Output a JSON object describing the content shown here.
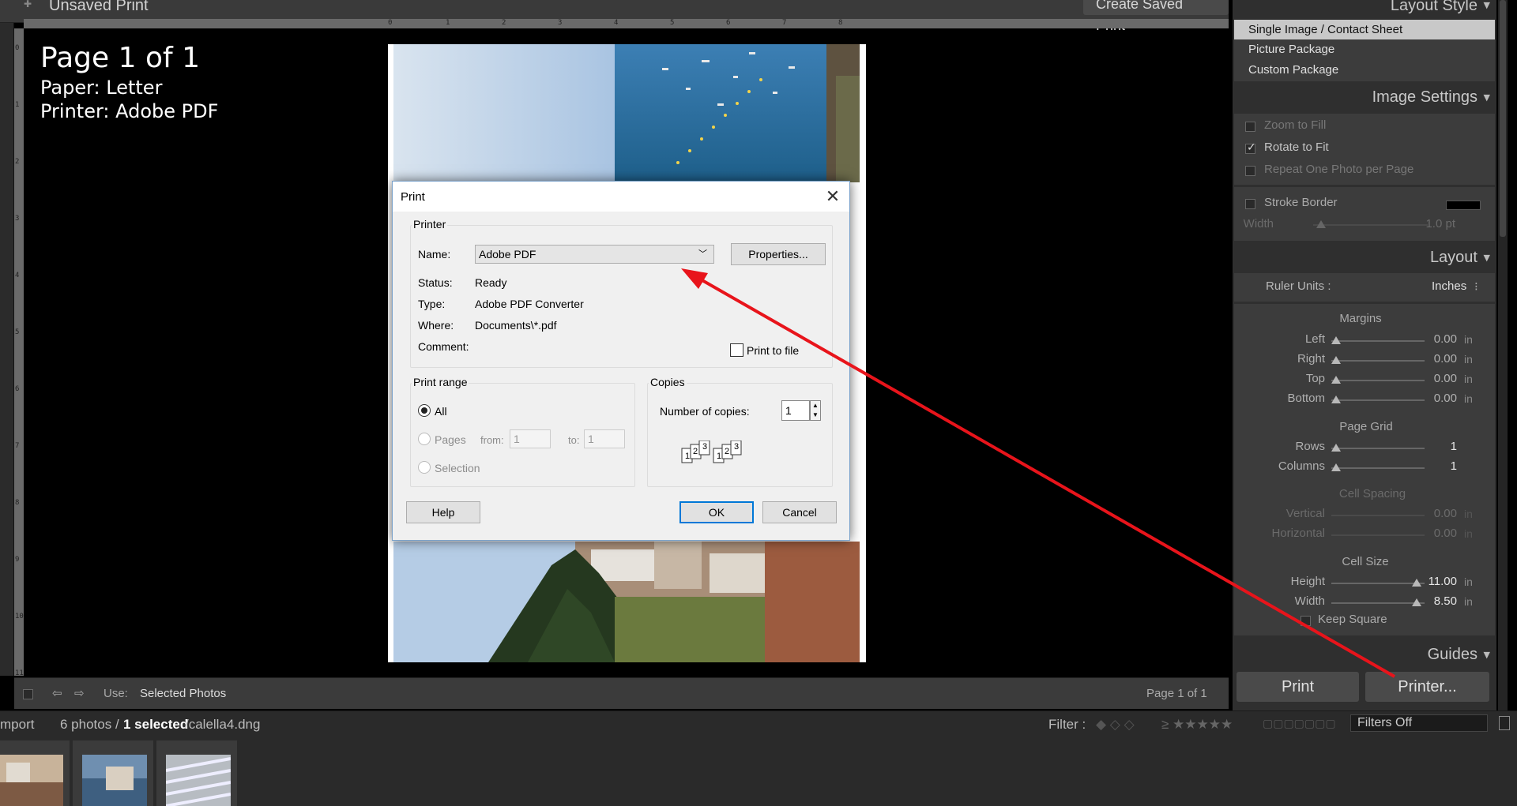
{
  "top_bar": {
    "title": "Unsaved Print",
    "create_saved_label": "Create Saved Print"
  },
  "rulers": {
    "top_ticks": [
      "0",
      "1",
      "2",
      "3",
      "4",
      "5",
      "6",
      "7",
      "8"
    ],
    "left_ticks": [
      "0",
      "1",
      "2",
      "3",
      "4",
      "5",
      "6",
      "7",
      "8",
      "9",
      "10",
      "11"
    ]
  },
  "info_overlay": {
    "page": "Page 1 of 1",
    "paper": "Paper:  Letter",
    "printer": "Printer:  Adobe PDF"
  },
  "print_dialog": {
    "title": "Print",
    "printer_group": "Printer",
    "name_label": "Name:",
    "printer_name": "Adobe PDF",
    "properties_label": "Properties...",
    "status_label": "Status:",
    "status_value": "Ready",
    "type_label": "Type:",
    "type_value": "Adobe PDF Converter",
    "where_label": "Where:",
    "where_value": "Documents\\*.pdf",
    "comment_label": "Comment:",
    "print_to_file_label": "Print to file",
    "print_range_group": "Print range",
    "range_all": "All",
    "range_pages": "Pages",
    "from_label": "from:",
    "from_value": "1",
    "to_label": "to:",
    "to_value": "1",
    "range_selection": "Selection",
    "copies_group": "Copies",
    "num_copies_label": "Number of copies:",
    "num_copies_value": "1",
    "collate_a": [
      "1",
      "2",
      "3"
    ],
    "collate_b": [
      "1",
      "2",
      "3"
    ],
    "help_label": "Help",
    "ok_label": "OK",
    "cancel_label": "Cancel"
  },
  "right_panel": {
    "layout_style": {
      "heading": "Layout Style",
      "items": [
        "Single Image / Contact Sheet",
        "Picture Package",
        "Custom Package"
      ],
      "selected_index": 0
    },
    "image_settings": {
      "heading": "Image Settings",
      "zoom_to_fill": "Zoom to Fill",
      "rotate_to_fit": "Rotate to Fit",
      "repeat_one": "Repeat One Photo per Page",
      "stroke_border": "Stroke Border",
      "width_label": "Width",
      "width_value": "1.0 pt",
      "checked": {
        "zoom_to_fill": false,
        "rotate_to_fit": true,
        "repeat_one": false,
        "stroke_border": false
      }
    },
    "layout": {
      "heading": "Layout",
      "ruler_units_label": "Ruler Units :",
      "ruler_units_value": "Inches",
      "margins_heading": "Margins",
      "margins": [
        {
          "label": "Left",
          "value": "0.00",
          "unit": "in"
        },
        {
          "label": "Right",
          "value": "0.00",
          "unit": "in"
        },
        {
          "label": "Top",
          "value": "0.00",
          "unit": "in"
        },
        {
          "label": "Bottom",
          "value": "0.00",
          "unit": "in"
        }
      ],
      "page_grid_heading": "Page Grid",
      "rows_label": "Rows",
      "rows_value": "1",
      "columns_label": "Columns",
      "columns_value": "1",
      "cell_spacing_heading": "Cell Spacing",
      "vertical_label": "Vertical",
      "vertical_value": "0.00",
      "horizontal_label": "Horizontal",
      "horizontal_value": "0.00",
      "cell_size_heading": "Cell Size",
      "height_label": "Height",
      "height_value": "11.00",
      "width_label": "Width",
      "width_value": "8.50",
      "unit": "in",
      "keep_square_label": "Keep Square"
    },
    "guides_heading": "Guides",
    "print_label": "Print",
    "printer_label": "Printer..."
  },
  "toolbar": {
    "use_label": "Use:",
    "use_value": "Selected Photos",
    "page_indicator": "Page 1 of 1"
  },
  "filmstrip_bar": {
    "import_label": "mport",
    "count_prefix": "6 photos /",
    "selected_text": "1 selected",
    "file_suffix": "/calella4.dng",
    "filter_label": "Filter :",
    "filters_off": "Filters Off"
  },
  "colors": {
    "annotation_arrow": "#e8141b",
    "dialog_accent": "#0078d7",
    "panel_bg": "#2f2f2f"
  }
}
